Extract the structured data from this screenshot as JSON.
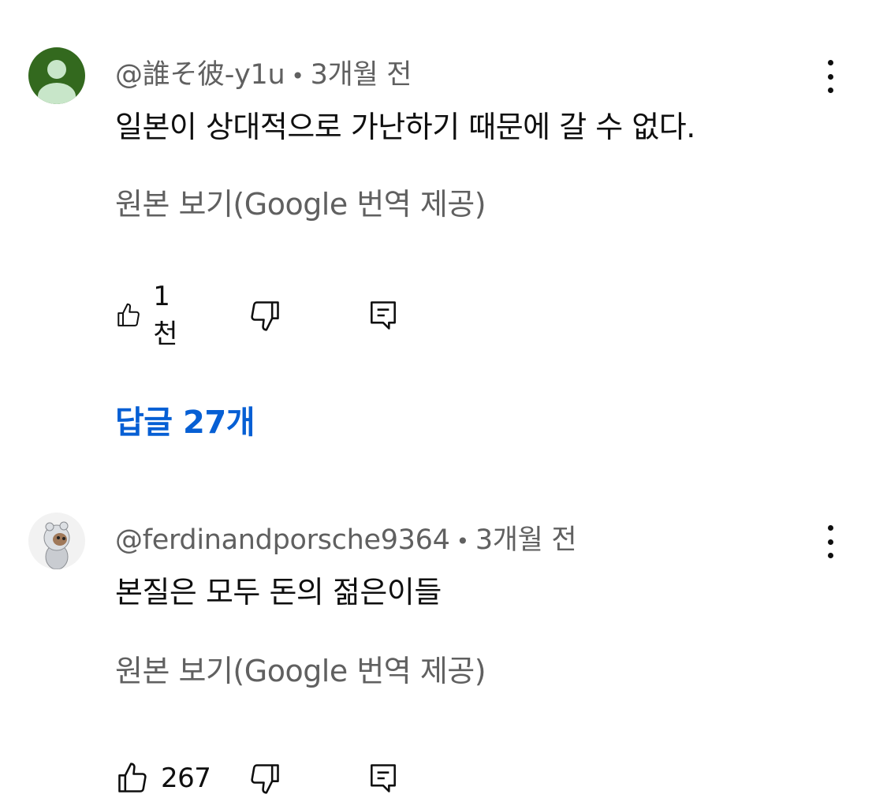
{
  "comments": [
    {
      "author": "@誰そ彼-y1u",
      "time": "3개월 전",
      "text": "일본이 상대적으로 가난하기 때문에 갈 수 없다.",
      "translate_label": "원본 보기(Google 번역 제공)",
      "likes": "1천",
      "replies_label": "답글 27개",
      "avatar_color": "#33691e"
    },
    {
      "author": "@ferdinandporsche9364",
      "time": "3개월 전",
      "text": "본질은 모두 돈의 젊은이들",
      "translate_label": "원본 보기(Google 번역 제공)",
      "likes": "267"
    }
  ],
  "separator": "•",
  "icons": {
    "like": "thumbs-up-icon",
    "dislike": "thumbs-down-icon",
    "reply": "reply-icon",
    "more": "more-vertical-icon"
  },
  "colors": {
    "link": "#065fd4",
    "secondary_text": "#606060",
    "primary_text": "#0f0f0f"
  }
}
